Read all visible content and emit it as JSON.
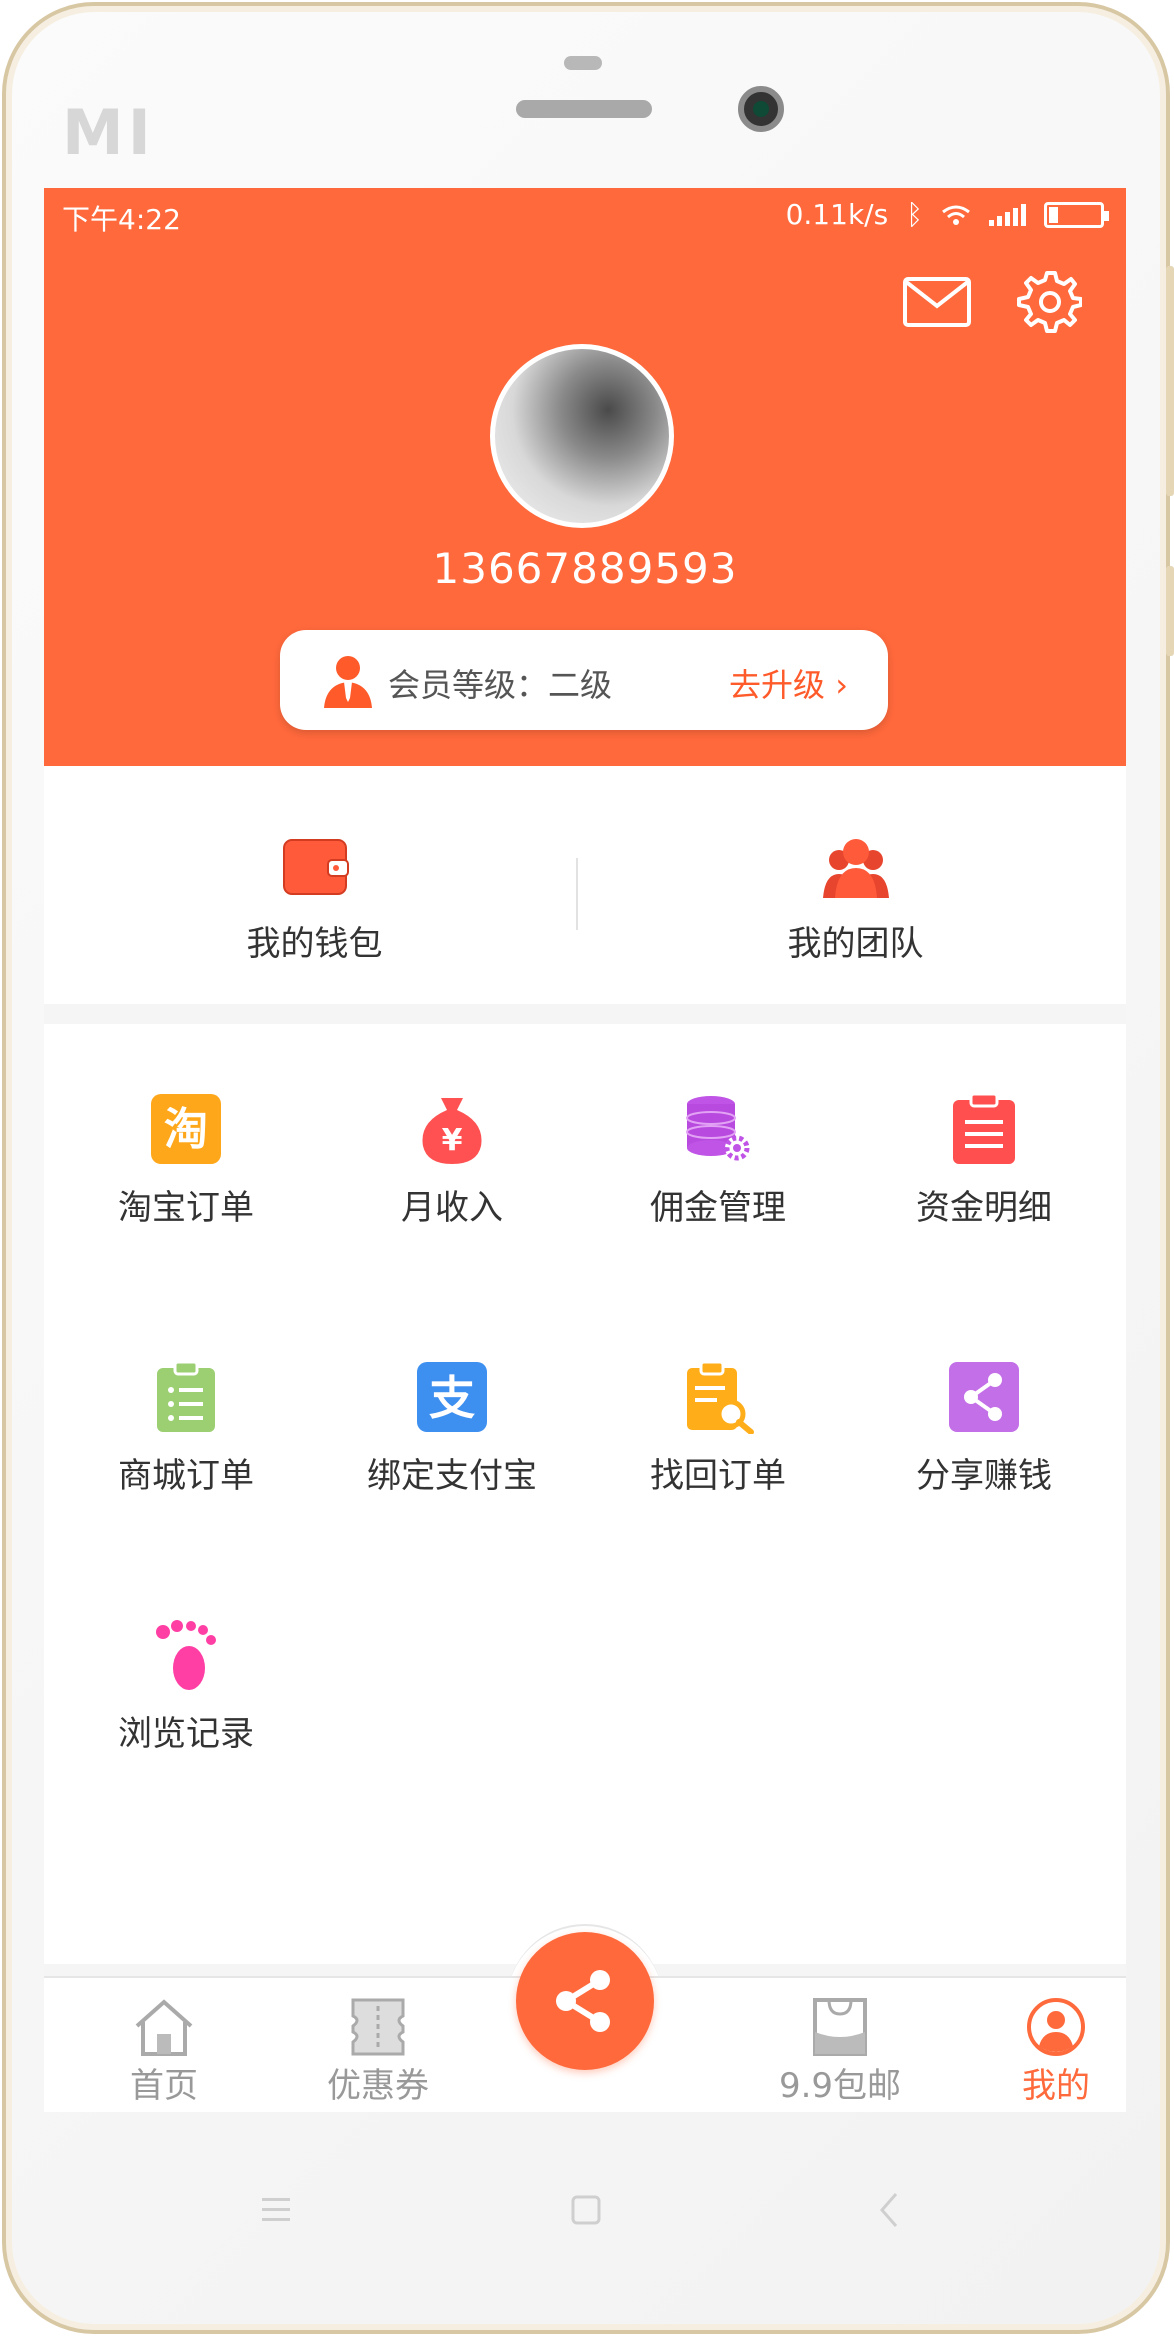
{
  "device": {
    "brand": "MI"
  },
  "status_bar": {
    "time": "下午4:22",
    "speed": "0.11k/s"
  },
  "profile": {
    "phone": "13667889593",
    "member_level": "会员等级：二级",
    "upgrade": "去升级"
  },
  "wallet_row": [
    {
      "label": "我的钱包",
      "icon": "wallet-icon"
    },
    {
      "label": "我的团队",
      "icon": "team-icon"
    }
  ],
  "menu": [
    {
      "label": "淘宝订单",
      "icon": "taobao-icon",
      "icon_text": "淘",
      "color": "#ffa71a"
    },
    {
      "label": "月收入",
      "icon": "money-bag-icon",
      "icon_text": "¥",
      "color": "#ff5151"
    },
    {
      "label": "佣金管理",
      "icon": "database-gear-icon",
      "color": "#c054e6"
    },
    {
      "label": "资金明细",
      "icon": "clipboard-list-icon",
      "color": "#ff4f4f"
    },
    {
      "label": "商城订单",
      "icon": "clipboard-check-icon",
      "color": "#9ccf71"
    },
    {
      "label": "绑定支付宝",
      "icon": "alipay-icon",
      "icon_text": "支",
      "color": "#3d8ff0"
    },
    {
      "label": "找回订单",
      "icon": "search-document-icon",
      "color": "#ffae1a"
    },
    {
      "label": "分享赚钱",
      "icon": "share-icon",
      "color": "#c36fe8"
    },
    {
      "label": "浏览记录",
      "icon": "footprint-icon",
      "color": "#ff3fa4"
    }
  ],
  "tabs": [
    {
      "label": "首页",
      "icon": "home-icon"
    },
    {
      "label": "优惠券",
      "icon": "coupon-icon"
    },
    {
      "label": "9.9包邮",
      "icon": "shopping-bag-icon"
    },
    {
      "label": "我的",
      "icon": "profile-icon",
      "active": true
    }
  ],
  "colors": {
    "accent": "#ff693c",
    "background": "#f5f5f5"
  }
}
